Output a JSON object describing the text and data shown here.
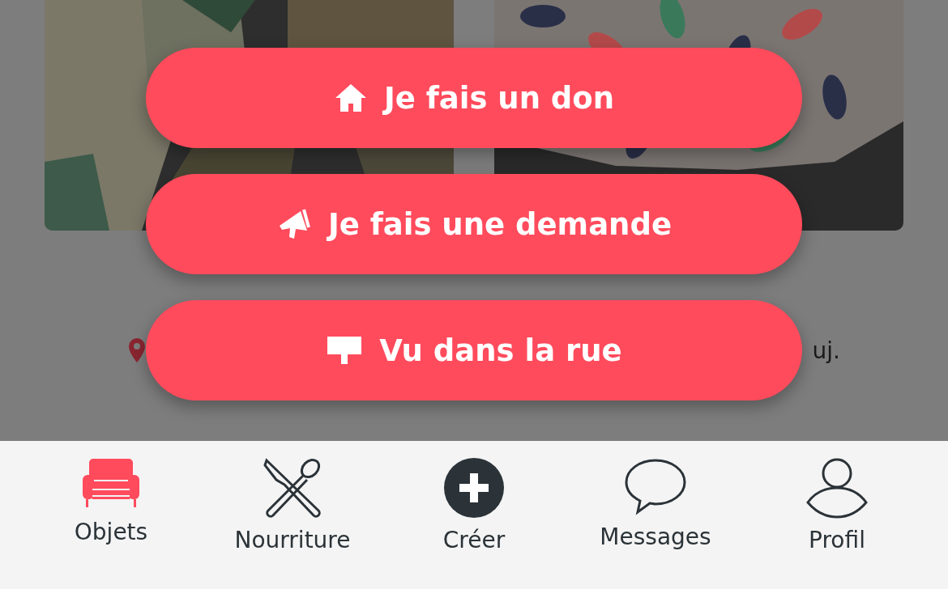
{
  "listings": [
    {
      "kind": "clothes"
    },
    {
      "kind": "tank-top",
      "meta": "uj."
    }
  ],
  "actions": [
    {
      "kind": "home",
      "label": "Je fais un don"
    },
    {
      "kind": "megaphone",
      "label": "Je fais une demande"
    },
    {
      "kind": "sign",
      "label": "Vu dans la rue"
    }
  ],
  "tabs": [
    {
      "kind": "sofa",
      "label": "Objets",
      "selected": true
    },
    {
      "kind": "food",
      "label": "Nourriture",
      "selected": false
    },
    {
      "kind": "plus",
      "label": "Créer",
      "selected": false
    },
    {
      "kind": "chat",
      "label": "Messages",
      "selected": false
    },
    {
      "kind": "person",
      "label": "Profil",
      "selected": false
    }
  ]
}
